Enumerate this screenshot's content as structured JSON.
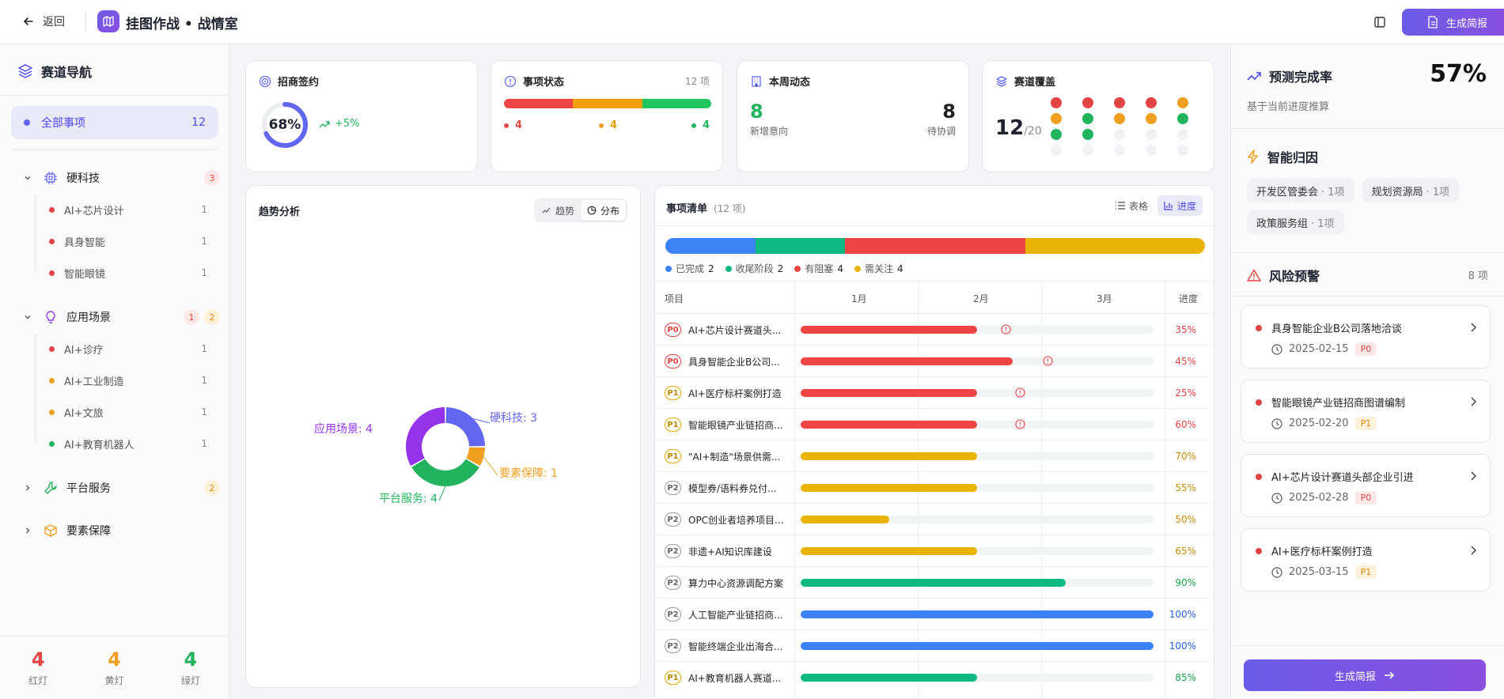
{
  "header": {
    "back_label": "返回",
    "title": "挂图作战 • 战情室",
    "generate_label": "生成简报"
  },
  "sidebar": {
    "title": "赛道导航",
    "all": {
      "label": "全部事项",
      "count": "12"
    },
    "groups": [
      {
        "label": "硬科技",
        "badges": [
          "3"
        ],
        "items": [
          {
            "label": "AI+芯片设计",
            "count": "1",
            "color": "#e24444"
          },
          {
            "label": "具身智能",
            "count": "1",
            "color": "#e24444"
          },
          {
            "label": "智能眼镜",
            "count": "1",
            "color": "#e24444"
          }
        ]
      },
      {
        "label": "应用场景",
        "badges": [
          "1",
          "2"
        ],
        "items": [
          {
            "label": "AI+诊疗",
            "count": "1",
            "color": "#e24444"
          },
          {
            "label": "AI+工业制造",
            "count": "1",
            "color": "#f0a020"
          },
          {
            "label": "AI+文旅",
            "count": "1",
            "color": "#f0a020"
          },
          {
            "label": "AI+教育机器人",
            "count": "1",
            "color": "#22b35e"
          }
        ]
      },
      {
        "label": "平台服务",
        "badges": [
          "2"
        ]
      },
      {
        "label": "要素保障",
        "badges": []
      }
    ],
    "footer": [
      {
        "num": "4",
        "label": "红灯",
        "color": "#e24444"
      },
      {
        "num": "4",
        "label": "黄灯",
        "color": "#f0a020"
      },
      {
        "num": "4",
        "label": "绿灯",
        "color": "#22b35e"
      }
    ]
  },
  "cards": {
    "sign": {
      "title": "招商签约",
      "percent": "68%",
      "value": 0.68,
      "delta": "+5%"
    },
    "status": {
      "title": "事项状态",
      "count": "12 项",
      "red": "4",
      "yellow": "4",
      "green": "4"
    },
    "weekly": {
      "title": "本周动态",
      "new_num": "8",
      "new_label": "新增意向",
      "pending_num": "8",
      "pending_label": "待协调"
    },
    "coverage": {
      "title": "赛道覆盖",
      "covered": "12",
      "total": "/20",
      "grid": [
        [
          "#e24444",
          "#e24444",
          "#e24444",
          "#e24444",
          "#f0a020"
        ],
        [
          "#f0a020",
          "#22b35e",
          "#f0a020",
          "#f0a020",
          "#22b35e"
        ],
        [
          "#22b35e",
          "#22b35e",
          "#f1f1f3",
          "#f1f1f3",
          "#f1f1f3"
        ],
        [
          "#f1f1f3",
          "#f1f1f3",
          "#f1f1f3",
          "#f1f1f3",
          "#f1f1f3"
        ]
      ]
    }
  },
  "trend": {
    "title": "趋势分析",
    "tab_trend": "趋势",
    "tab_dist": "分布"
  },
  "chart_data": {
    "type": "pie",
    "series": [
      {
        "name": "硬科技",
        "value": 3,
        "color": "#6366f1"
      },
      {
        "name": "要素保障",
        "value": 1,
        "color": "#f0a020"
      },
      {
        "name": "平台服务",
        "value": 4,
        "color": "#22b35e"
      },
      {
        "name": "应用场景",
        "value": 4,
        "color": "#9333ea"
      }
    ],
    "labels": [
      "硬科技: 3",
      "要素保障: 1",
      "平台服务: 4",
      "应用场景: 4"
    ]
  },
  "tasks": {
    "title": "事项清单",
    "count": "(12 项)",
    "view_table": "表格",
    "view_progress": "进度",
    "summary": [
      {
        "label": "已完成",
        "value": "2",
        "color": "#3b82f6",
        "n": 2
      },
      {
        "label": "收尾阶段",
        "value": "2",
        "color": "#10b981",
        "n": 2
      },
      {
        "label": "有阻塞",
        "value": "4",
        "color": "#ef4444",
        "n": 4
      },
      {
        "label": "需关注",
        "value": "4",
        "color": "#eab308",
        "n": 4
      }
    ],
    "headers": {
      "item": "项目",
      "m1": "1月",
      "m2": "2月",
      "m3": "3月",
      "progress": "进度"
    },
    "rows": [
      {
        "p": "P0",
        "name": "AI+芯片设计赛道头...",
        "pct": "35%",
        "color": "#ef4444",
        "fill": 0.5,
        "warn": 0.58
      },
      {
        "p": "P0",
        "name": "具身智能企业B公司...",
        "pct": "45%",
        "color": "#ef4444",
        "fill": 0.6,
        "warn": 0.7
      },
      {
        "p": "P1",
        "name": "AI+医疗标杆案例打造",
        "pct": "25%",
        "color": "#ef4444",
        "fill": 0.5,
        "warn": 0.62
      },
      {
        "p": "P1",
        "name": "智能眼镜产业链招商...",
        "pct": "60%",
        "color": "#ef4444",
        "fill": 0.5,
        "warn": 0.62
      },
      {
        "p": "P1",
        "name": "\"AI+制造\"场景供需...",
        "pct": "70%",
        "color": "#eab308",
        "fill": 0.5
      },
      {
        "p": "P2",
        "name": "模型券/语料券兑付...",
        "pct": "55%",
        "color": "#eab308",
        "fill": 0.5
      },
      {
        "p": "P2",
        "name": "OPC创业者培养项目...",
        "pct": "50%",
        "color": "#eab308",
        "fill": 0.25
      },
      {
        "p": "P2",
        "name": "非遗+AI知识库建设",
        "pct": "65%",
        "color": "#eab308",
        "fill": 0.5
      },
      {
        "p": "P2",
        "name": "算力中心资源调配方案",
        "pct": "90%",
        "color": "#10b981",
        "fill": 0.75
      },
      {
        "p": "P2",
        "name": "人工智能产业链招商...",
        "pct": "100%",
        "color": "#3b82f6",
        "fill": 1.0
      },
      {
        "p": "P2",
        "name": "智能终端企业出海合...",
        "pct": "100%",
        "color": "#3b82f6",
        "fill": 1.0
      },
      {
        "p": "P1",
        "name": "AI+教育机器人赛道...",
        "pct": "85%",
        "color": "#10b981",
        "fill": 0.5
      }
    ]
  },
  "right": {
    "forecast_title": "预测完成率",
    "forecast_value": "57%",
    "forecast_sub": "基于当前进度推算",
    "attr_title": "智能归因",
    "chips": [
      {
        "a": "开发区管委会",
        "b": "· 1项"
      },
      {
        "a": "规划资源局",
        "b": "· 1项"
      },
      {
        "a": "政策服务组",
        "b": "· 1项"
      }
    ],
    "risk_title": "风险预警",
    "risk_count": "8 项",
    "risks": [
      {
        "title": "具身智能企业B公司落地洽谈",
        "date": "2025-02-15",
        "p": "P0"
      },
      {
        "title": "智能眼镜产业链招商图谱编制",
        "date": "2025-02-20",
        "p": "P1"
      },
      {
        "title": "AI+芯片设计赛道头部企业引进",
        "date": "2025-02-28",
        "p": "P0"
      },
      {
        "title": "AI+医疗标杆案例打造",
        "date": "2025-03-15",
        "p": "P1"
      }
    ],
    "generate_label": "生成简报"
  }
}
